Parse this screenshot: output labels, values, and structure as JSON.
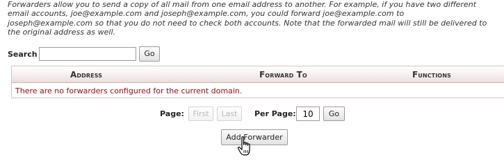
{
  "intro": {
    "lines": [
      "Forwarders allow you to send a copy of all mail from one email address to another. For example, if you have two different",
      "email accounts, joe@example.com and joseph@example.com, you could forward joe@example.com to",
      "joseph@example.com so that you do not need to check both accounts. Note that the forwarded mail will still be delivered to",
      "the original address as well."
    ]
  },
  "search": {
    "label": "Search",
    "value": "",
    "placeholder": "",
    "go_label": "Go"
  },
  "table": {
    "columns": [
      "Address",
      "Forward To",
      "Functions"
    ],
    "empty_message": "There are no forwarders configured for the current domain.",
    "empty_message_color": "#a80b14"
  },
  "pagination": {
    "page_label": "Page:",
    "first_label": "First",
    "last_label": "Last",
    "per_page_label": "Per Page:",
    "per_page_value": "10",
    "go_label": "Go"
  },
  "actions": {
    "add_forwarder_label": "Add Forwarder"
  },
  "cursor": {
    "icon": "hand-pointer-icon"
  }
}
